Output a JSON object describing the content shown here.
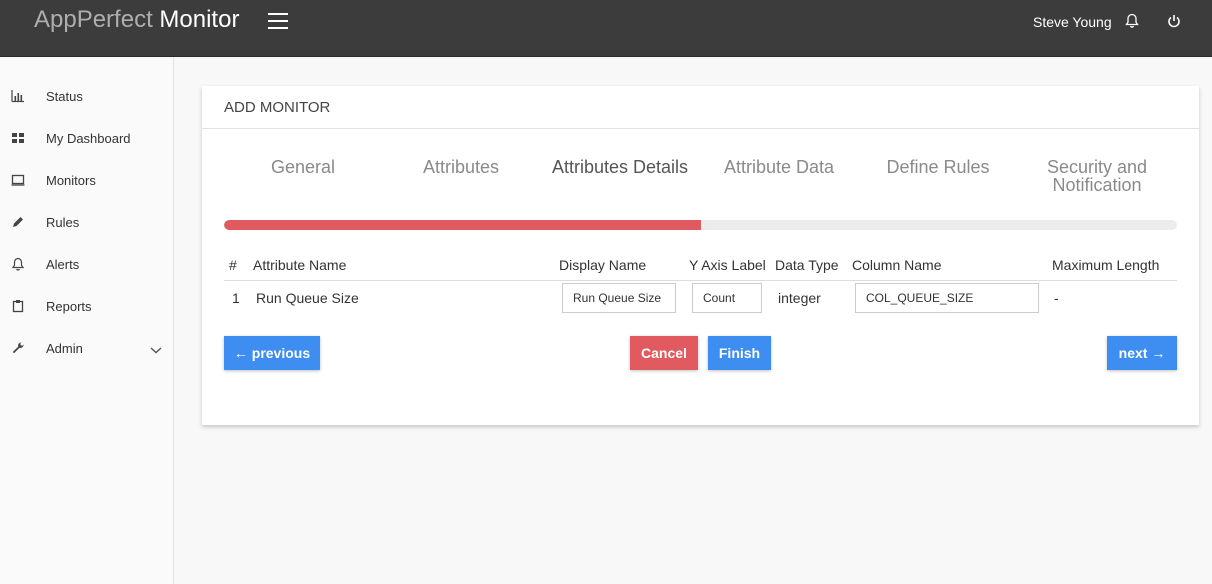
{
  "header": {
    "brand_light": "AppPerfect",
    "brand_bold": "Monitor",
    "user_name": "Steve Young",
    "icons": [
      "menu-icon",
      "bell-icon",
      "power-icon"
    ]
  },
  "sidebar": {
    "items": [
      {
        "label": "Status",
        "icon": "bar-chart-icon"
      },
      {
        "label": "My Dashboard",
        "icon": "grid-icon"
      },
      {
        "label": "Monitors",
        "icon": "monitor-icon"
      },
      {
        "label": "Rules",
        "icon": "pencil-icon"
      },
      {
        "label": "Alerts",
        "icon": "bell-icon"
      },
      {
        "label": "Reports",
        "icon": "clipboard-icon"
      },
      {
        "label": "Admin",
        "icon": "wrench-icon"
      }
    ]
  },
  "card": {
    "title": "ADD MONITOR",
    "steps": [
      "General",
      "Attributes",
      "Attributes Details",
      "Attribute Data",
      "Define Rules",
      "Security and Notification"
    ],
    "active_step": 2,
    "progress_percent": 50,
    "progress_color": "#e05a5f",
    "table": {
      "headers": [
        "#",
        "Attribute Name",
        "Display Name",
        "Y Axis Label",
        "Data Type",
        "Column Name",
        "Maximum Length"
      ],
      "rows": [
        {
          "index": "1",
          "attribute_name": "Run Queue Size",
          "display_name": "Run Queue Size",
          "y_axis_label": "Count",
          "data_type": "integer",
          "column_name": "COL_QUEUE_SIZE",
          "max_length": "-"
        }
      ]
    },
    "buttons": {
      "previous": "← previous",
      "cancel": "Cancel",
      "finish": "Finish",
      "next": "next →"
    }
  }
}
